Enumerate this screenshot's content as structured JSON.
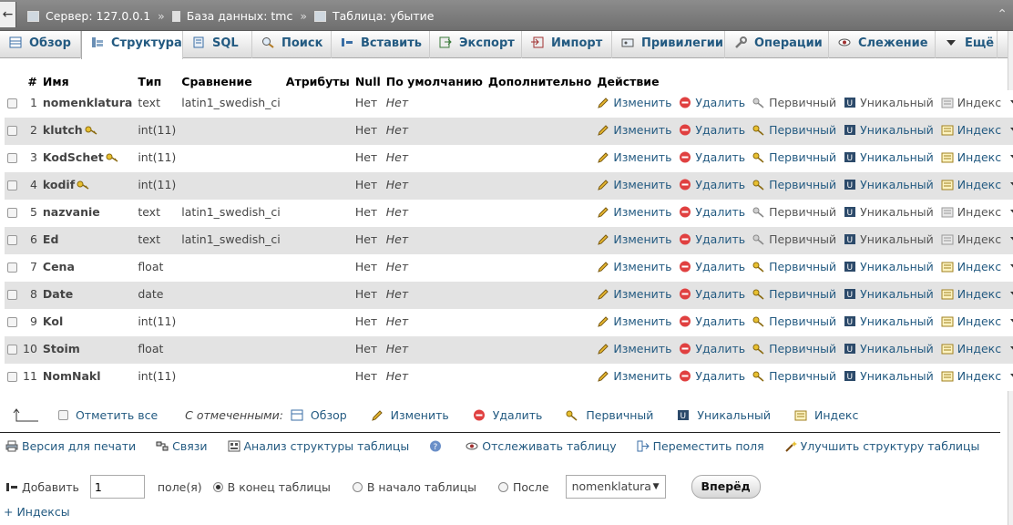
{
  "breadcrumb": {
    "server": "Сервер: 127.0.0.1",
    "database": "База данных: tmc",
    "table": "Таблица: убытие"
  },
  "tabs": [
    {
      "label": "Обзор",
      "icon": "browse-icon"
    },
    {
      "label": "Структура",
      "icon": "structure-icon"
    },
    {
      "label": "SQL",
      "icon": "sql-icon"
    },
    {
      "label": "Поиск",
      "icon": "search-icon"
    },
    {
      "label": "Вставить",
      "icon": "insert-icon"
    },
    {
      "label": "Экспорт",
      "icon": "export-icon"
    },
    {
      "label": "Импорт",
      "icon": "import-icon"
    },
    {
      "label": "Привилегии",
      "icon": "privileges-icon"
    },
    {
      "label": "Операции",
      "icon": "wrench-icon"
    },
    {
      "label": "Слежение",
      "icon": "eye-icon"
    },
    {
      "label": "Ещё",
      "icon": "chevron-down-icon"
    }
  ],
  "columns": [
    "#",
    "Имя",
    "Тип",
    "Сравнение",
    "Атрибуты",
    "Null",
    "По умолчанию",
    "Дополнительно",
    "Действие"
  ],
  "actions": {
    "edit": "Изменить",
    "delete": "Удалить",
    "primary": "Первичный",
    "unique": "Уникальный",
    "index": "Индекс",
    "more": "Ещё"
  },
  "rows": [
    {
      "num": "1",
      "name": "nomenklatura",
      "type": "text",
      "collation": "latin1_swedish_ci",
      "null": "Нет",
      "default": "Нет",
      "key": false,
      "text_type": true
    },
    {
      "num": "2",
      "name": "klutch",
      "type": "int(11)",
      "collation": "",
      "null": "Нет",
      "default": "Нет",
      "key": true,
      "text_type": false
    },
    {
      "num": "3",
      "name": "KodSchet",
      "type": "int(11)",
      "collation": "",
      "null": "Нет",
      "default": "Нет",
      "key": true,
      "text_type": false
    },
    {
      "num": "4",
      "name": "kodif",
      "type": "int(11)",
      "collation": "",
      "null": "Нет",
      "default": "Нет",
      "key": true,
      "text_type": false
    },
    {
      "num": "5",
      "name": "nazvanie",
      "type": "text",
      "collation": "latin1_swedish_ci",
      "null": "Нет",
      "default": "Нет",
      "key": false,
      "text_type": true
    },
    {
      "num": "6",
      "name": "Ed",
      "type": "text",
      "collation": "latin1_swedish_ci",
      "null": "Нет",
      "default": "Нет",
      "key": false,
      "text_type": true
    },
    {
      "num": "7",
      "name": "Cena",
      "type": "float",
      "collation": "",
      "null": "Нет",
      "default": "Нет",
      "key": false,
      "text_type": false
    },
    {
      "num": "8",
      "name": "Date",
      "type": "date",
      "collation": "",
      "null": "Нет",
      "default": "Нет",
      "key": false,
      "text_type": false
    },
    {
      "num": "9",
      "name": "Kol",
      "type": "int(11)",
      "collation": "",
      "null": "Нет",
      "default": "Нет",
      "key": false,
      "text_type": false
    },
    {
      "num": "10",
      "name": "Stoim",
      "type": "float",
      "collation": "",
      "null": "Нет",
      "default": "Нет",
      "key": false,
      "text_type": false
    },
    {
      "num": "11",
      "name": "NomNakl",
      "type": "int(11)",
      "collation": "",
      "null": "Нет",
      "default": "Нет",
      "key": false,
      "text_type": false
    }
  ],
  "with_selected": {
    "check_all": "Отметить все",
    "label": "С отмеченными:",
    "browse": "Обзор",
    "edit": "Изменить",
    "delete": "Удалить",
    "primary": "Первичный",
    "unique": "Уникальный",
    "index": "Индекс"
  },
  "links": {
    "print": "Версия для печати",
    "relations": "Связи",
    "analyze": "Анализ структуры таблицы",
    "track": "Отслеживать таблицу",
    "move": "Переместить поля",
    "improve": "Улучшить структуру таблицы"
  },
  "add": {
    "label": "Добавить",
    "count": "1",
    "fields_label": "поле(я)",
    "at_end": "В конец таблицы",
    "at_start": "В начало таблицы",
    "after": "После",
    "after_field": "nomenklatura",
    "go": "Вперёд"
  },
  "indexes_link": "+ Индексы",
  "colors": {
    "link": "#235a81",
    "row_alt": "#e3e3e3",
    "crumb_bg": "#7d7d7d"
  }
}
